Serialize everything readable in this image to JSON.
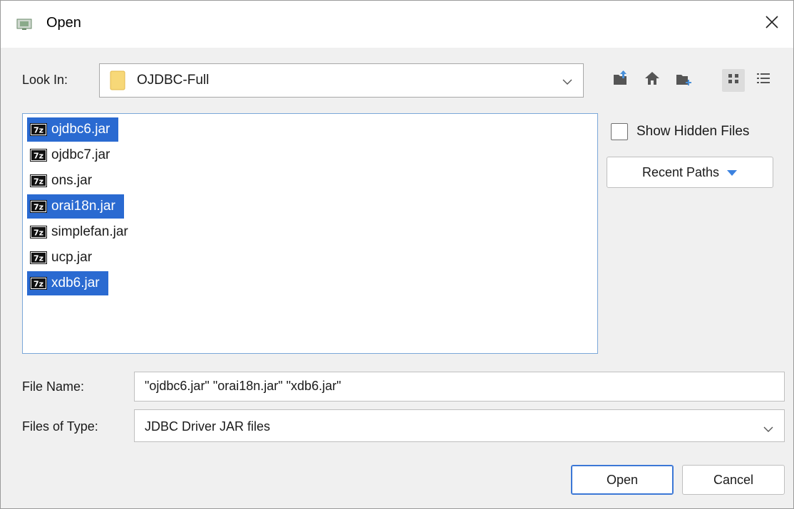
{
  "window": {
    "title": "Open",
    "close_glyph": "✕"
  },
  "look_in": {
    "label": "Look In:",
    "value": "OJDBC-Full"
  },
  "toolbar": {
    "icons": [
      "up-one-level-icon",
      "home-icon",
      "new-folder-icon",
      "list-view-icon",
      "details-view-icon"
    ]
  },
  "files": [
    {
      "name": "ojdbc6.jar",
      "selected": true
    },
    {
      "name": "ojdbc7.jar",
      "selected": false
    },
    {
      "name": "ons.jar",
      "selected": false
    },
    {
      "name": "orai18n.jar",
      "selected": true
    },
    {
      "name": "simplefan.jar",
      "selected": false
    },
    {
      "name": "ucp.jar",
      "selected": false
    },
    {
      "name": "xdb6.jar",
      "selected": true
    }
  ],
  "options": {
    "show_hidden_label": "Show Hidden Files",
    "show_hidden_checked": false,
    "recent_paths_label": "Recent Paths"
  },
  "file_name": {
    "label": "File Name:",
    "value": "\"ojdbc6.jar\" \"orai18n.jar\" \"xdb6.jar\""
  },
  "file_type": {
    "label": "Files of Type:",
    "value": "JDBC Driver JAR files"
  },
  "buttons": {
    "open": "Open",
    "cancel": "Cancel"
  },
  "colors": {
    "selection": "#2a6ad1",
    "accent": "#3b77d6",
    "icon_blue": "#4a90d9"
  }
}
